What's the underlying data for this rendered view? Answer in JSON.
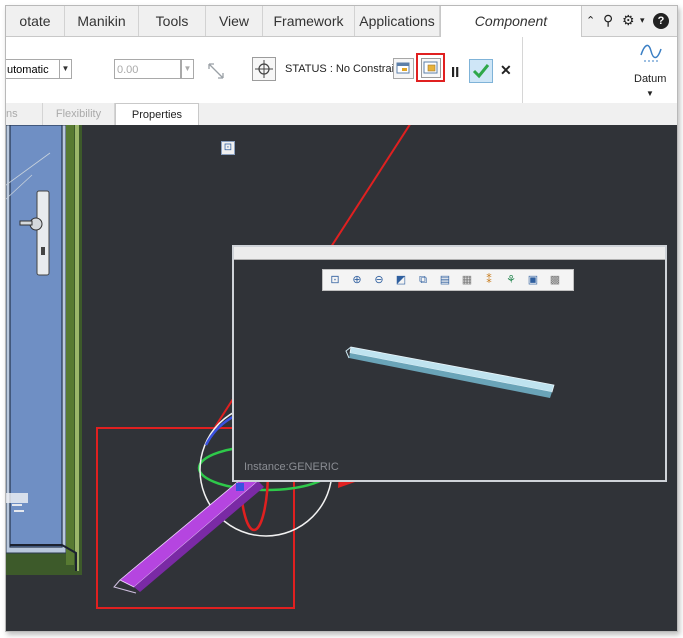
{
  "tabs": [
    "otate",
    "Manikin",
    "Tools",
    "View",
    "Framework",
    "Applications",
    "Component Placement"
  ],
  "header_icons": [
    "chevron-up-icon",
    "search-icon",
    "settings-icon",
    "help-icon"
  ],
  "ribbon": {
    "constraint_select": "utomatic",
    "offset_value": "0.00",
    "status_text": "STATUS : No Constraints",
    "datum_label": "Datum",
    "pause_label": "II",
    "confirm_label": "✓",
    "cancel_label": "✕"
  },
  "subtabs": [
    "ns",
    "Flexibility",
    "Properties"
  ],
  "preview": {
    "instance_label": "Instance:GENERIC",
    "toolbar_icons": [
      "zoom-fit-icon",
      "zoom-in-icon",
      "zoom-out-icon",
      "shading-icon",
      "view-orient-icon",
      "saved-views-icon",
      "display-style-icon",
      "datum-display-icon",
      "spin-center-icon",
      "annotation-icon",
      "render-icon"
    ]
  },
  "colors": {
    "viewport_bg": "#303338",
    "highlight": "#e02020",
    "accent_green": "#2ec94a"
  }
}
